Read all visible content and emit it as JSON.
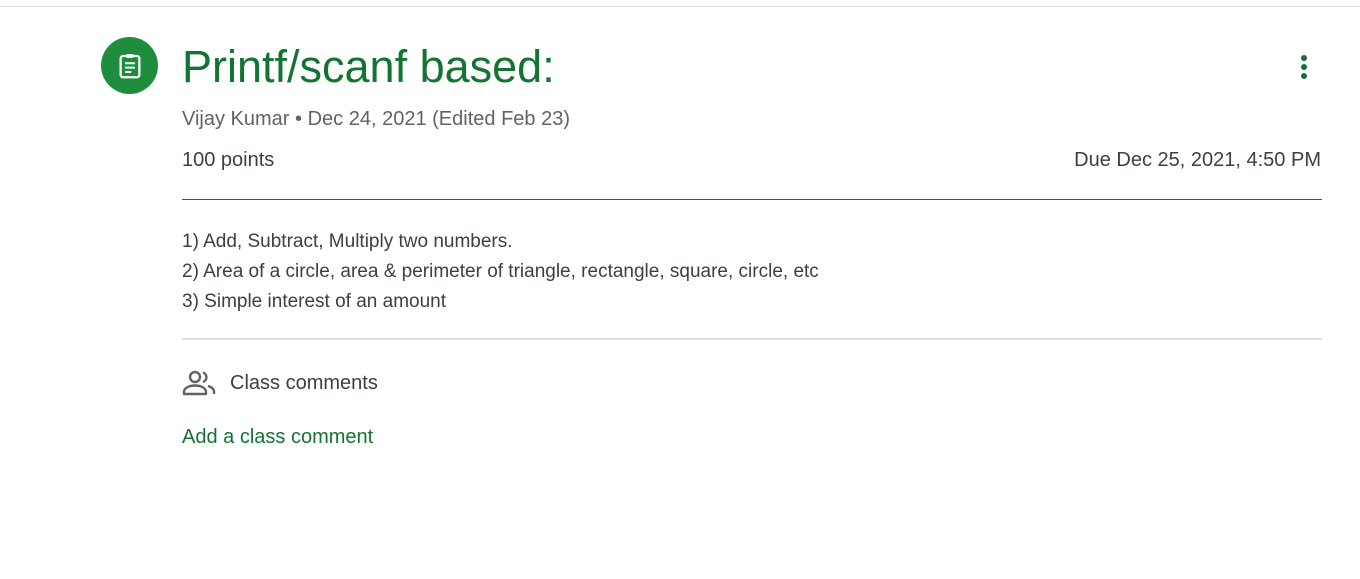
{
  "assignment": {
    "title": "Printf/scanf based:",
    "author": "Vijay Kumar",
    "separator": "•",
    "posted_date": "Dec 24, 2021",
    "edited": "(Edited Feb 23)",
    "points": "100 points",
    "due": "Due Dec 25, 2021, 4:50 PM",
    "icon": "assignment-icon",
    "more_icon": "more-vert-icon",
    "instructions": [
      "1) Add, Subtract, Multiply two numbers.",
      "2) Area of a circle, area & perimeter of triangle, rectangle, square, circle, etc",
      "3) Simple interest of an amount"
    ]
  },
  "comments": {
    "icon": "people-icon",
    "header": "Class comments",
    "add_link": "Add a class comment"
  },
  "colors": {
    "accent": "#137333",
    "icon_bg": "#1e8e3e",
    "text": "#3c4043",
    "muted": "#5f6368"
  }
}
